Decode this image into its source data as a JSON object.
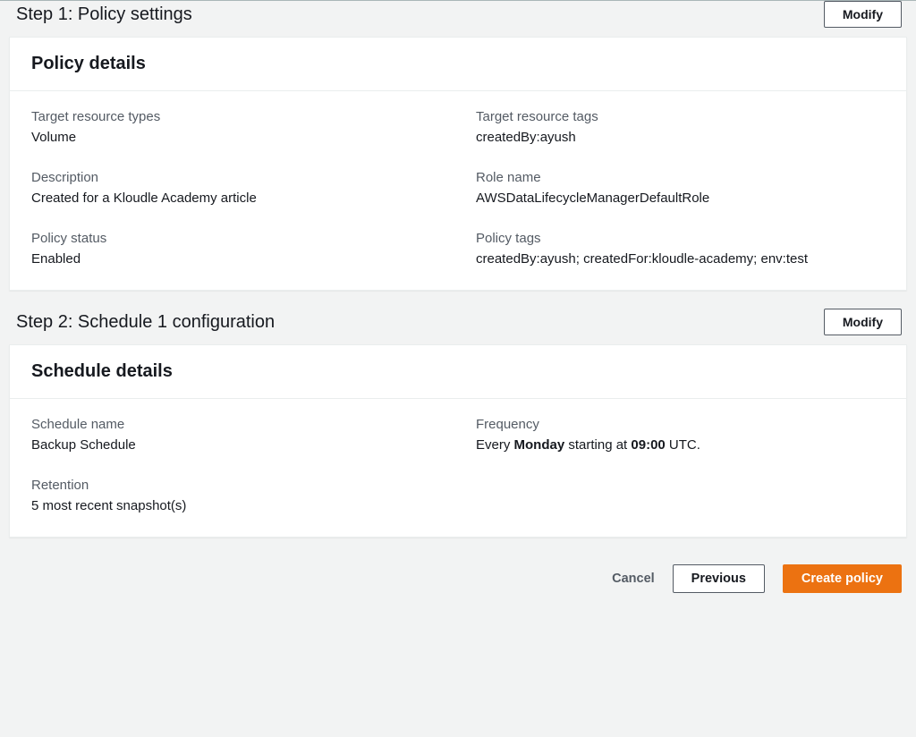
{
  "step1": {
    "title": "Step 1: Policy settings",
    "modify_label": "Modify",
    "card_title": "Policy details",
    "fields": {
      "target_resource_types": {
        "label": "Target resource types",
        "value": "Volume"
      },
      "target_resource_tags": {
        "label": "Target resource tags",
        "value": "createdBy:ayush"
      },
      "description": {
        "label": "Description",
        "value": "Created for a Kloudle Academy article"
      },
      "role_name": {
        "label": "Role name",
        "value": "AWSDataLifecycleManagerDefaultRole"
      },
      "policy_status": {
        "label": "Policy status",
        "value": "Enabled"
      },
      "policy_tags": {
        "label": "Policy tags",
        "value": "createdBy:ayush; createdFor:kloudle-academy; env:test"
      }
    }
  },
  "step2": {
    "title": "Step 2: Schedule 1 configuration",
    "modify_label": "Modify",
    "card_title": "Schedule details",
    "fields": {
      "schedule_name": {
        "label": "Schedule name",
        "value": "Backup Schedule"
      },
      "frequency": {
        "label": "Frequency",
        "prefix": "Every ",
        "day": "Monday",
        "mid": " starting at ",
        "time": "09:00",
        "suffix": " UTC."
      },
      "retention": {
        "label": "Retention",
        "value": "5 most recent snapshot(s)"
      }
    }
  },
  "footer": {
    "cancel_label": "Cancel",
    "previous_label": "Previous",
    "create_label": "Create policy"
  }
}
